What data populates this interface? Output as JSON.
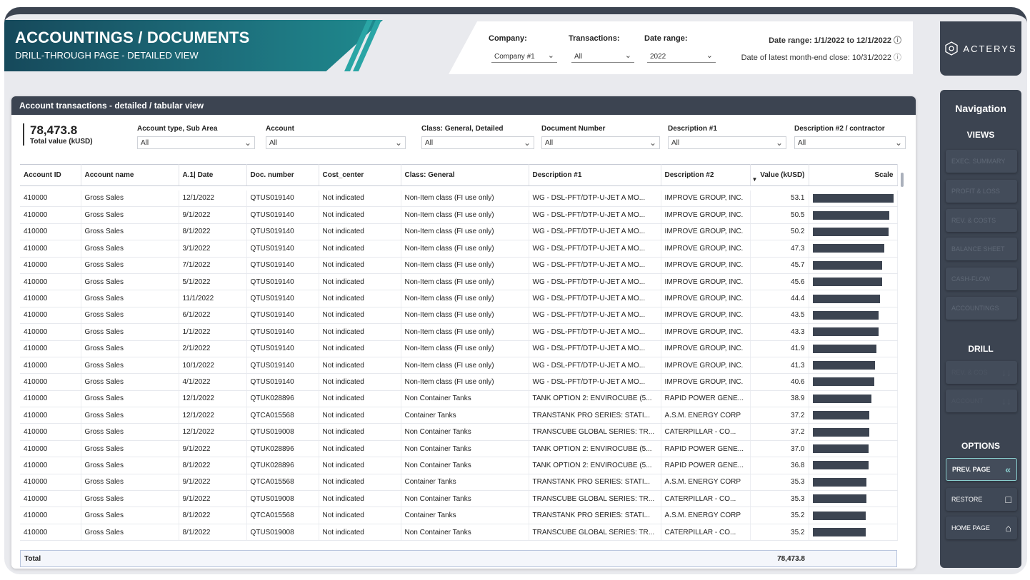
{
  "header": {
    "title": "ACCOUNTINGS / DOCUMENTS",
    "subtitle": "DRILL-THROUGH PAGE - DETAILED VIEW"
  },
  "top_filters": {
    "company_label": "Company:",
    "company_value": "Company #1",
    "transactions_label": "Transactions:",
    "transactions_value": "All",
    "date_range_label": "Date range:",
    "date_range_value": "2022",
    "date_range_info": "Date range: 1/1/2022 to 12/1/2022",
    "month_end_info": "Date of latest month-end close: 10/31/2022"
  },
  "logo": {
    "text": "ACTERYS",
    "icon": "acterys-logo-icon"
  },
  "navigation": {
    "title": "Navigation",
    "views_title": "VIEWS",
    "views": [
      "EXEC. SUMMARY",
      "PROFIT & LOSS",
      "REV. & COSTS",
      "BALANCE SHEET",
      "CASH-FLOW",
      "ACCOUNTINGS"
    ],
    "drill_title": "DRILL",
    "drill": [
      "REV. & COS",
      "ACCOUNT"
    ],
    "options_title": "OPTIONS",
    "options": [
      "PREV. PAGE",
      "RESTORE",
      "HOME PAGE"
    ]
  },
  "card": {
    "title": "Account transactions - detailed / tabular view",
    "kpi_value": "78,473.8",
    "kpi_label": "Total value (kUSD)",
    "slicers": [
      {
        "label": "Account type, Sub Area",
        "value": "All"
      },
      {
        "label": "Account",
        "value": "All"
      },
      {
        "label": "Class: General, Detailed",
        "value": "All"
      },
      {
        "label": "Document Number",
        "value": "All"
      },
      {
        "label": "Description #1",
        "value": "All"
      },
      {
        "label": "Description #2 / contractor",
        "value": "All"
      }
    ]
  },
  "table": {
    "columns": [
      "Account ID",
      "Account name",
      "A.1| Date",
      "Doc. number",
      "Cost_center",
      "Class: General",
      "Description #1",
      "Description #2",
      "Value (kUSD)",
      "Scale"
    ],
    "max_value": 53.1,
    "rows": [
      [
        "410000",
        "Gross Sales",
        "12/1/2022",
        "QTUS019140",
        "Not indicated",
        "Non-Item class (FI use only)",
        "WG - DSL-PFT/DTP-U-JET A MO...",
        "IMPROVE GROUP, INC.",
        "53.1"
      ],
      [
        "410000",
        "Gross Sales",
        "9/1/2022",
        "QTUS019140",
        "Not indicated",
        "Non-Item class (FI use only)",
        "WG - DSL-PFT/DTP-U-JET A MO...",
        "IMPROVE GROUP, INC.",
        "50.5"
      ],
      [
        "410000",
        "Gross Sales",
        "8/1/2022",
        "QTUS019140",
        "Not indicated",
        "Non-Item class (FI use only)",
        "WG - DSL-PFT/DTP-U-JET A MO...",
        "IMPROVE GROUP, INC.",
        "50.2"
      ],
      [
        "410000",
        "Gross Sales",
        "3/1/2022",
        "QTUS019140",
        "Not indicated",
        "Non-Item class (FI use only)",
        "WG - DSL-PFT/DTP-U-JET A MO...",
        "IMPROVE GROUP, INC.",
        "47.3"
      ],
      [
        "410000",
        "Gross Sales",
        "7/1/2022",
        "QTUS019140",
        "Not indicated",
        "Non-Item class (FI use only)",
        "WG - DSL-PFT/DTP-U-JET A MO...",
        "IMPROVE GROUP, INC.",
        "45.7"
      ],
      [
        "410000",
        "Gross Sales",
        "5/1/2022",
        "QTUS019140",
        "Not indicated",
        "Non-Item class (FI use only)",
        "WG - DSL-PFT/DTP-U-JET A MO...",
        "IMPROVE GROUP, INC.",
        "45.6"
      ],
      [
        "410000",
        "Gross Sales",
        "11/1/2022",
        "QTUS019140",
        "Not indicated",
        "Non-Item class (FI use only)",
        "WG - DSL-PFT/DTP-U-JET A MO...",
        "IMPROVE GROUP, INC.",
        "44.4"
      ],
      [
        "410000",
        "Gross Sales",
        "6/1/2022",
        "QTUS019140",
        "Not indicated",
        "Non-Item class (FI use only)",
        "WG - DSL-PFT/DTP-U-JET A MO...",
        "IMPROVE GROUP, INC.",
        "43.5"
      ],
      [
        "410000",
        "Gross Sales",
        "1/1/2022",
        "QTUS019140",
        "Not indicated",
        "Non-Item class (FI use only)",
        "WG - DSL-PFT/DTP-U-JET A MO...",
        "IMPROVE GROUP, INC.",
        "43.3"
      ],
      [
        "410000",
        "Gross Sales",
        "2/1/2022",
        "QTUS019140",
        "Not indicated",
        "Non-Item class (FI use only)",
        "WG - DSL-PFT/DTP-U-JET A MO...",
        "IMPROVE GROUP, INC.",
        "41.9"
      ],
      [
        "410000",
        "Gross Sales",
        "10/1/2022",
        "QTUS019140",
        "Not indicated",
        "Non-Item class (FI use only)",
        "WG - DSL-PFT/DTP-U-JET A MO...",
        "IMPROVE GROUP, INC.",
        "41.3"
      ],
      [
        "410000",
        "Gross Sales",
        "4/1/2022",
        "QTUS019140",
        "Not indicated",
        "Non-Item class (FI use only)",
        "WG - DSL-PFT/DTP-U-JET A MO...",
        "IMPROVE GROUP, INC.",
        "40.6"
      ],
      [
        "410000",
        "Gross Sales",
        "12/1/2022",
        "QTUK028896",
        "Not indicated",
        "Non Container Tanks",
        "TANK OPTION 2:  ENVIROCUBE (5...",
        "RAPID POWER GENE...",
        "38.9"
      ],
      [
        "410000",
        "Gross Sales",
        "12/1/2022",
        "QTCA015568",
        "Not indicated",
        "Container Tanks",
        "TRANSTANK PRO SERIES: STATI...",
        "A.S.M. ENERGY CORP",
        "37.2"
      ],
      [
        "410000",
        "Gross Sales",
        "12/1/2022",
        "QTUS019008",
        "Not indicated",
        "Non Container Tanks",
        "TRANSCUBE GLOBAL SERIES: TR...",
        "CATERPILLAR - CO...",
        "37.2"
      ],
      [
        "410000",
        "Gross Sales",
        "9/1/2022",
        "QTUK028896",
        "Not indicated",
        "Non Container Tanks",
        "TANK OPTION 2:  ENVIROCUBE (5...",
        "RAPID POWER GENE...",
        "37.0"
      ],
      [
        "410000",
        "Gross Sales",
        "8/1/2022",
        "QTUK028896",
        "Not indicated",
        "Non Container Tanks",
        "TANK OPTION 2:  ENVIROCUBE (5...",
        "RAPID POWER GENE...",
        "36.8"
      ],
      [
        "410000",
        "Gross Sales",
        "9/1/2022",
        "QTCA015568",
        "Not indicated",
        "Container Tanks",
        "TRANSTANK PRO SERIES: STATI...",
        "A.S.M. ENERGY CORP",
        "35.3"
      ],
      [
        "410000",
        "Gross Sales",
        "9/1/2022",
        "QTUS019008",
        "Not indicated",
        "Non Container Tanks",
        "TRANSCUBE GLOBAL SERIES: TR...",
        "CATERPILLAR - CO...",
        "35.3"
      ],
      [
        "410000",
        "Gross Sales",
        "8/1/2022",
        "QTCA015568",
        "Not indicated",
        "Container Tanks",
        "TRANSTANK PRO SERIES: STATI...",
        "A.S.M. ENERGY CORP",
        "35.2"
      ],
      [
        "410000",
        "Gross Sales",
        "8/1/2022",
        "QTUS019008",
        "Not indicated",
        "Non Container Tanks",
        "TRANSCUBE GLOBAL SERIES: TR...",
        "CATERPILLAR - CO...",
        "35.2"
      ]
    ],
    "total_label": "Total",
    "total_value": "78,473.8"
  },
  "colors": {
    "bar": "#3c4451",
    "banner_start": "#16495b",
    "banner_end": "#1f8a8e",
    "nav_bg": "#3c4451",
    "prev_border": "#8ad0d0"
  }
}
